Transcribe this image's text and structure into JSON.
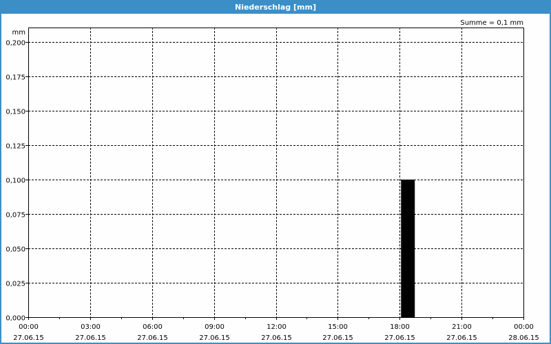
{
  "window": {
    "title": "Niederschlag [mm]",
    "title_bar_color": "#3c8fc6"
  },
  "chart_data": {
    "type": "bar",
    "title": "Niederschlag [mm]",
    "ylabel": "mm",
    "annotation": "Summe = 0,1 mm",
    "ylim": [
      0,
      0.2
    ],
    "y_ticks": [
      "0,000",
      "0,025",
      "0,050",
      "0,075",
      "0,100",
      "0,125",
      "0,150",
      "0,175",
      "0,200"
    ],
    "x_ticks": [
      {
        "time": "00:00",
        "date": "27.06.15"
      },
      {
        "time": "03:00",
        "date": "27.06.15"
      },
      {
        "time": "06:00",
        "date": "27.06.15"
      },
      {
        "time": "09:00",
        "date": "27.06.15"
      },
      {
        "time": "12:00",
        "date": "27.06.15"
      },
      {
        "time": "15:00",
        "date": "27.06.15"
      },
      {
        "time": "18:00",
        "date": "27.06.15"
      },
      {
        "time": "21:00",
        "date": "27.06.15"
      },
      {
        "time": "00:00",
        "date": "28.06.15"
      }
    ],
    "xlim_hours": [
      0,
      24
    ],
    "grid": true,
    "bar_color": "#000000",
    "bars": [
      {
        "x": "27.06.15 18:00",
        "hour": 18,
        "value": 0.1
      }
    ]
  }
}
